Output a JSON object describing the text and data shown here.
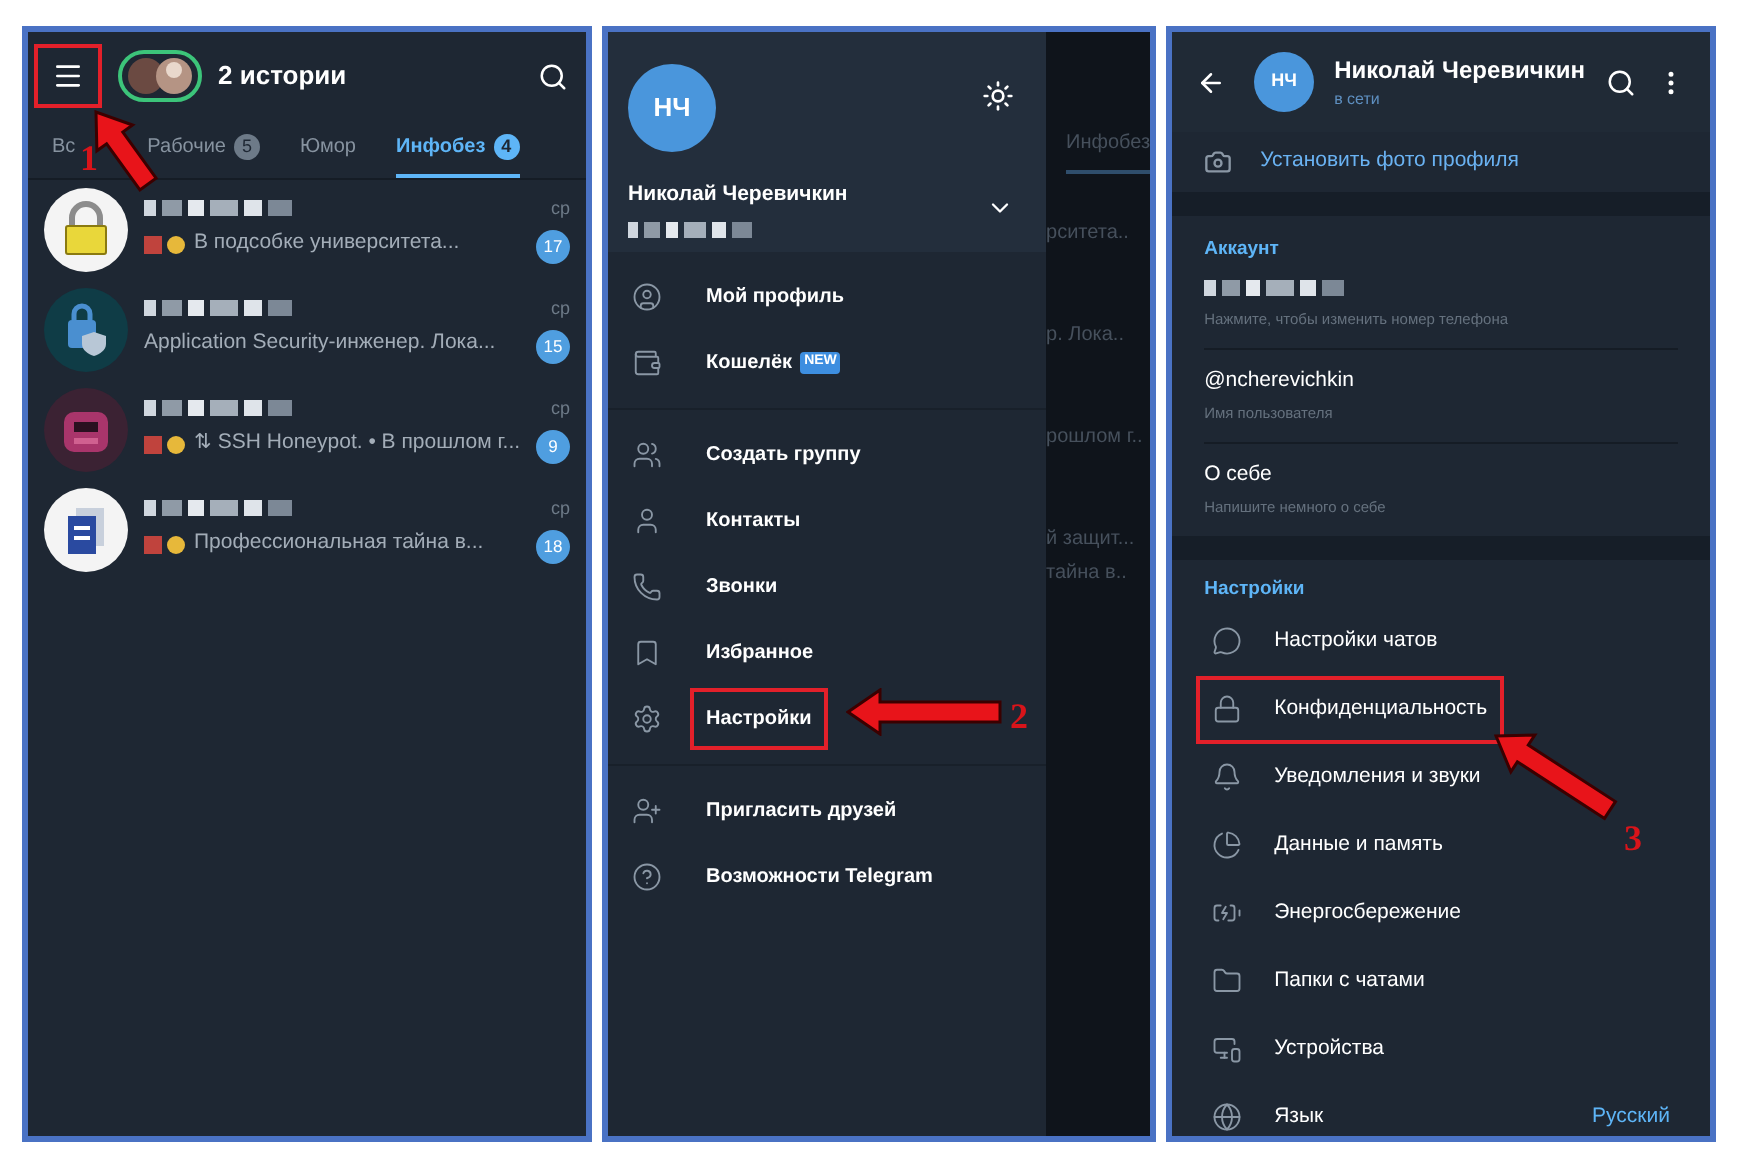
{
  "chat_list": {
    "menu_highlighted": true,
    "title": "2 истории",
    "tabs": [
      {
        "label": "Вс",
        "selected": false
      },
      {
        "label": "Рабочие",
        "badge": "5",
        "selected": false
      },
      {
        "label": "Юмор",
        "selected": false
      },
      {
        "label": "Инфобез",
        "badge": "4",
        "selected": true
      }
    ],
    "chats": [
      {
        "preview": "В подсобке университета...",
        "emoji": true,
        "time": "ср",
        "unread": "17"
      },
      {
        "preview": "Application Security-инженер. Лока...",
        "emoji": false,
        "time": "ср",
        "unread": "15"
      },
      {
        "preview": "⇅ SSH Honeypot. • В прошлом г...",
        "emoji": true,
        "time": "ср",
        "unread": "9"
      },
      {
        "preview": "Профессиональная тайна в...",
        "emoji": true,
        "time": "ср",
        "unread": "18"
      }
    ]
  },
  "drawer": {
    "avatar": "НЧ",
    "name": "Николай Черевичкин",
    "groups": [
      [
        {
          "label": "Мой профиль",
          "highlighted": false
        },
        {
          "label": "Кошелёк",
          "tag": "NEW",
          "highlighted": false
        }
      ],
      [
        {
          "label": "Создать группу",
          "highlighted": false
        },
        {
          "label": "Контакты",
          "highlighted": false
        },
        {
          "label": "Звонки",
          "highlighted": false
        },
        {
          "label": "Избранное",
          "highlighted": false
        },
        {
          "label": "Настройки",
          "highlighted": true
        }
      ],
      [
        {
          "label": "Пригласить друзей",
          "highlighted": false
        },
        {
          "label": "Возможности Telegram",
          "highlighted": false
        }
      ]
    ],
    "backdrop": {
      "tab": "Инфобез",
      "lines": [
        "рситета..",
        "р. Лока..",
        "рошлом г..",
        "й защит...",
        "тайна в.."
      ]
    }
  },
  "profile": {
    "avatar": "НЧ",
    "name": "Николай Черевичкин",
    "status": "в сети",
    "set_photo": "Установить фото профиля",
    "account": {
      "heading": "Аккаунт",
      "phone_hint": "Нажмите, чтобы изменить номер телефона",
      "fields": [
        {
          "value": "@ncherevichkin",
          "hint": "Имя пользователя"
        },
        {
          "value": "О себе",
          "hint": "Напишите немного о себе"
        }
      ]
    },
    "settings": {
      "heading": "Настройки",
      "items": [
        {
          "label": "Настройки чатов",
          "highlighted": false
        },
        {
          "label": "Конфиденциальность",
          "highlighted": true
        },
        {
          "label": "Уведомления и звуки",
          "highlighted": false
        },
        {
          "label": "Данные и память",
          "highlighted": false
        },
        {
          "label": "Энергосбережение",
          "highlighted": false
        },
        {
          "label": "Папки с чатами",
          "highlighted": false
        },
        {
          "label": "Устройства",
          "highlighted": false
        },
        {
          "label": "Язык",
          "value": "Русский",
          "highlighted": false
        }
      ]
    }
  },
  "annotations": [
    {
      "number": "1"
    },
    {
      "number": "2"
    },
    {
      "number": "3"
    }
  ]
}
